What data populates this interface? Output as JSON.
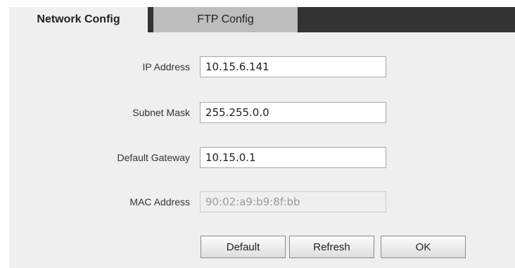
{
  "tabs": {
    "network_config": "Network Config",
    "ftp_config": "FTP Config"
  },
  "form": {
    "ip_address": {
      "label": "IP Address",
      "value": "10.15.6.141"
    },
    "subnet_mask": {
      "label": "Subnet Mask",
      "value": "255.255.0.0"
    },
    "default_gateway": {
      "label": "Default Gateway",
      "value": "10.15.0.1"
    },
    "mac_address": {
      "label": "MAC Address",
      "value": "90:02:a9:b9:8f:bb"
    }
  },
  "buttons": {
    "default": "Default",
    "refresh": "Refresh",
    "ok": "OK"
  },
  "colors": {
    "tab_bar": "#333333",
    "active_tab": "#efefef",
    "inactive_tab": "#bdbdbd",
    "panel": "#efefef"
  }
}
